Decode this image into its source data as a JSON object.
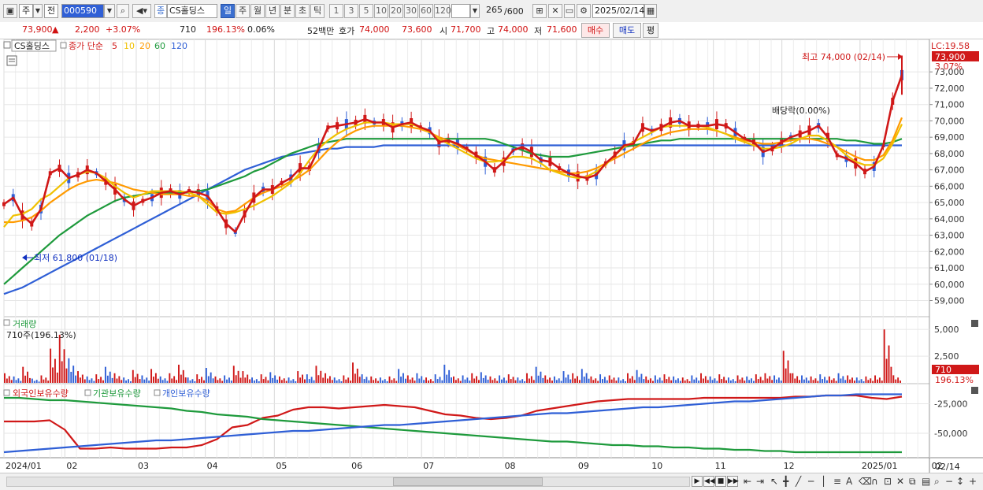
{
  "toolbar": {
    "period_type": "주",
    "prev_label": "전",
    "stock_code": "000590",
    "stock_badge": "종",
    "stock_name": "CS홀딩스",
    "period_tabs": [
      "일",
      "주",
      "월",
      "년",
      "분",
      "초",
      "틱"
    ],
    "interval_buttons": [
      "1",
      "3",
      "5",
      "10",
      "20",
      "30",
      "60",
      "120"
    ],
    "count_value": "265",
    "count_total": "/600",
    "date_value": "2025/02/14"
  },
  "info": {
    "price": "73,900",
    "change_arrow": "▲",
    "change": "2,200",
    "change_pct": "+3.07%",
    "volume": "710",
    "volume_ratio": "196.13%",
    "turnover": "0.06%",
    "week52_label": "52백만",
    "ask_label": "호가",
    "ask": "74,000",
    "bid": "73,600",
    "open_label": "시",
    "open": "71,700",
    "high_label": "고",
    "high": "74,000",
    "low_label": "저",
    "low": "71,600",
    "buy_button": "매수",
    "sell_button": "매도",
    "eval_button": "평"
  },
  "chart_data": [
    {
      "type": "candlestick",
      "legend": {
        "stock": "CS홀딩스",
        "ma_label": "종가 단순",
        "periods": [
          "5",
          "10",
          "20",
          "60",
          "120"
        ],
        "colors": [
          "#d01818",
          "#f0c000",
          "#ff9a00",
          "#1e9a3c",
          "#2f5fd6"
        ]
      },
      "y_ticks": [
        59000,
        60000,
        61000,
        62000,
        63000,
        64000,
        65000,
        66000,
        67000,
        68000,
        69000,
        70000,
        71000,
        72000,
        73000
      ],
      "y_tick_labels": [
        "59,000",
        "60,000",
        "61,000",
        "62,000",
        "63,000",
        "64,000",
        "65,000",
        "66,000",
        "67,000",
        "68,000",
        "69,000",
        "70,000",
        "71,000",
        "72,000",
        "73,000"
      ],
      "ylim": [
        58300,
        74700
      ],
      "lc_label": "LC:19.58",
      "last_price_label": "73,900",
      "last_pct_label": "3.07%",
      "last_price": 73900,
      "high_annotation": "최고 74,000 (02/14)",
      "high_value": 74000,
      "low_annotation": "최저 61,800 (01/18)",
      "low_value": 61800,
      "dividend_annotation": "배당락(0.00%)",
      "series": [
        {
          "name": "5",
          "color": "#d01818",
          "values": [
            64900,
            65300,
            64200,
            63700,
            64600,
            66800,
            67100,
            66500,
            66700,
            67000,
            66800,
            66300,
            65800,
            65200,
            64800,
            65100,
            65300,
            65600,
            65700,
            65500,
            65700,
            65600,
            65400,
            64600,
            63700,
            63200,
            64300,
            65300,
            65800,
            65800,
            66200,
            66500,
            67100,
            67100,
            68300,
            69600,
            69700,
            69800,
            69900,
            70100,
            69900,
            69900,
            69600,
            69800,
            69900,
            69600,
            69400,
            68700,
            68800,
            68600,
            68300,
            67900,
            67500,
            67000,
            67500,
            68200,
            68400,
            68100,
            67600,
            67500,
            67100,
            66800,
            66600,
            66500,
            66700,
            67400,
            67900,
            68500,
            68600,
            69600,
            69400,
            69600,
            69900,
            70000,
            69700,
            69700,
            69700,
            69800,
            69700,
            69300,
            68900,
            68700,
            68100,
            68300,
            68700,
            69000,
            69200,
            69400,
            69700,
            69000,
            67900,
            67700,
            67400,
            66900,
            67200,
            68500,
            71200,
            72800
          ]
        },
        {
          "name": "10",
          "color": "#f0c000",
          "values": [
            63500,
            64200,
            64300,
            64600,
            65200,
            65500,
            66000,
            66500,
            66700,
            66900,
            66800,
            66500,
            66000,
            65600,
            65300,
            65500,
            65700,
            65700,
            65700,
            65700,
            65600,
            65400,
            64900,
            64400,
            64300,
            64400,
            64600,
            64800,
            65100,
            65400,
            65800,
            66200,
            66800,
            67600,
            68300,
            68800,
            69200,
            69500,
            69700,
            69900,
            69900,
            69900,
            69800,
            69800,
            69800,
            69600,
            69300,
            68900,
            68600,
            68300,
            68000,
            67700,
            67500,
            67500,
            67600,
            67800,
            67800,
            67700,
            67400,
            67000,
            66800,
            66600,
            66500,
            66600,
            66900,
            67300,
            67900,
            68400,
            68700,
            69000,
            69300,
            69600,
            69700,
            69700,
            69700,
            69700,
            69600,
            69400,
            69200,
            68900,
            68700,
            68500,
            68300,
            68300,
            68400,
            68600,
            68900,
            69100,
            69100,
            68800,
            68400,
            67900,
            67500,
            67300,
            67300,
            67700,
            68600,
            69800
          ]
        },
        {
          "name": "20",
          "color": "#ff9a00",
          "values": [
            63800,
            63800,
            63900,
            64100,
            64500,
            65000,
            65400,
            65800,
            66100,
            66300,
            66400,
            66300,
            66200,
            66000,
            65800,
            65700,
            65600,
            65500,
            65500,
            65500,
            65400,
            65400,
            65100,
            64600,
            64400,
            64500,
            64900,
            65300,
            65600,
            65800,
            66000,
            66300,
            66600,
            67000,
            67600,
            68200,
            68700,
            69100,
            69400,
            69600,
            69700,
            69700,
            69700,
            69700,
            69600,
            69500,
            69300,
            69000,
            68800,
            68500,
            68200,
            67900,
            67700,
            67600,
            67500,
            67400,
            67300,
            67200,
            67100,
            67000,
            66900,
            66800,
            66800,
            66900,
            67100,
            67400,
            67700,
            68000,
            68300,
            68600,
            68900,
            69100,
            69300,
            69400,
            69500,
            69500,
            69500,
            69400,
            69200,
            69000,
            68800,
            68700,
            68600,
            68600,
            68700,
            68800,
            68900,
            68900,
            68800,
            68600,
            68400,
            68100,
            67800,
            67600,
            67600,
            67900,
            68800,
            70200
          ]
        },
        {
          "name": "60",
          "color": "#1e9a3c",
          "values": [
            60000,
            60500,
            61000,
            61500,
            62000,
            62500,
            63000,
            63400,
            63800,
            64200,
            64500,
            64800,
            65100,
            65300,
            65400,
            65500,
            65600,
            65600,
            65600,
            65600,
            65600,
            65700,
            65800,
            66000,
            66200,
            66400,
            66600,
            66900,
            67100,
            67400,
            67700,
            68000,
            68200,
            68400,
            68600,
            68700,
            68800,
            68900,
            68900,
            68900,
            68900,
            68900,
            68900,
            68900,
            68900,
            68900,
            68900,
            68900,
            68900,
            68900,
            68900,
            68900,
            68900,
            68800,
            68600,
            68400,
            68200,
            68000,
            67900,
            67800,
            67800,
            67800,
            67900,
            68000,
            68100,
            68200,
            68300,
            68400,
            68500,
            68600,
            68700,
            68800,
            68800,
            68900,
            68900,
            68900,
            68900,
            68900,
            68900,
            68900,
            68900,
            68900,
            68900,
            68900,
            68900,
            68900,
            68900,
            68900,
            68900,
            68900,
            68900,
            68800,
            68800,
            68700,
            68600,
            68600,
            68700,
            68900
          ]
        },
        {
          "name": "120",
          "color": "#2f5fd6",
          "values": [
            59400,
            59600,
            59800,
            60100,
            60400,
            60700,
            61000,
            61300,
            61600,
            61900,
            62200,
            62500,
            62800,
            63100,
            63400,
            63700,
            64000,
            64300,
            64600,
            64900,
            65200,
            65500,
            65800,
            66100,
            66400,
            66700,
            67000,
            67200,
            67400,
            67600,
            67800,
            67900,
            68000,
            68100,
            68200,
            68300,
            68300,
            68400,
            68400,
            68400,
            68400,
            68500,
            68500,
            68500,
            68500,
            68500,
            68500,
            68500,
            68500,
            68500,
            68500,
            68500,
            68500,
            68500,
            68500,
            68500,
            68500,
            68500,
            68500,
            68500,
            68500,
            68500,
            68500,
            68500,
            68500,
            68500,
            68500,
            68500,
            68500,
            68500,
            68500,
            68500,
            68500,
            68500,
            68500,
            68500,
            68500,
            68500,
            68500,
            68500,
            68500,
            68500,
            68500,
            68500,
            68500,
            68500,
            68500,
            68500,
            68500,
            68500,
            68500,
            68500,
            68500,
            68500,
            68500,
            68500,
            68500,
            68500
          ]
        }
      ]
    },
    {
      "type": "bar",
      "title": "거래량",
      "subtitle": "710주(196.13%)",
      "y_ticks": [
        2500,
        5000
      ],
      "y_tick_labels": [
        "2,500",
        "5,000"
      ],
      "ylim": [
        0,
        5600
      ],
      "last_volume_label": "710",
      "last_pct_label": "196.13%",
      "values": [
        900,
        600,
        1500,
        400,
        700,
        3200,
        4500,
        2300,
        1100,
        600,
        800,
        1500,
        900,
        500,
        1200,
        700,
        1300,
        600,
        900,
        1700,
        500,
        800,
        1400,
        600,
        700,
        1600,
        1100,
        500,
        800,
        1000,
        600,
        500,
        1100,
        800,
        1600,
        900,
        500,
        700,
        1900,
        800,
        600,
        500,
        600,
        1300,
        700,
        900,
        500,
        800,
        1700,
        600,
        700,
        900,
        1000,
        600,
        700,
        800,
        500,
        900,
        1500,
        700,
        600,
        1100,
        900,
        1300,
        600,
        800,
        700,
        500,
        900,
        1200,
        600,
        700,
        800,
        600,
        500,
        700,
        900,
        600,
        800,
        500,
        700,
        600,
        800,
        900,
        700,
        3000,
        900,
        700,
        600,
        800,
        600,
        900,
        700,
        500,
        600,
        700,
        5000,
        710
      ],
      "colors": [
        "r",
        "b",
        "r",
        "b",
        "r",
        "r",
        "r",
        "b",
        "r",
        "b",
        "r",
        "b",
        "r",
        "b",
        "r",
        "b",
        "r",
        "b",
        "r",
        "r",
        "b",
        "r",
        "b",
        "r",
        "b",
        "r",
        "r",
        "b",
        "r",
        "b",
        "r",
        "b",
        "r",
        "b",
        "r",
        "r",
        "b",
        "r",
        "r",
        "b",
        "r",
        "b",
        "r",
        "b",
        "r",
        "b",
        "r",
        "b",
        "b",
        "r",
        "b",
        "r",
        "b",
        "r",
        "b",
        "r",
        "b",
        "r",
        "b",
        "r",
        "b",
        "b",
        "r",
        "b",
        "r",
        "b",
        "r",
        "b",
        "r",
        "b",
        "r",
        "b",
        "r",
        "b",
        "r",
        "b",
        "r",
        "b",
        "r",
        "b",
        "r",
        "b",
        "r",
        "r",
        "b",
        "r",
        "r",
        "b",
        "r",
        "b",
        "r",
        "b",
        "r",
        "b",
        "r",
        "r",
        "r",
        "r"
      ]
    },
    {
      "type": "line",
      "legend": [
        "외국인보유수량",
        "기관보유수량",
        "개인보유수량"
      ],
      "y_ticks": [
        -25000,
        -50000
      ],
      "y_tick_labels": [
        "-25,000",
        "-50,000"
      ],
      "ylim": [
        -68000,
        -12000
      ],
      "series": [
        {
          "name": "외국인보유수량",
          "color": "#d01818",
          "values": [
            -40000,
            -40000,
            -40000,
            -39000,
            -47000,
            -63000,
            -63000,
            -62000,
            -63000,
            -63000,
            -63000,
            -62000,
            -62000,
            -60000,
            -55000,
            -45000,
            -43000,
            -37000,
            -35000,
            -30000,
            -28000,
            -28000,
            -29000,
            -28000,
            -27000,
            -26000,
            -27000,
            -28000,
            -31000,
            -34000,
            -35000,
            -37000,
            -38000,
            -37000,
            -35000,
            -31000,
            -29000,
            -27000,
            -25000,
            -23000,
            -22000,
            -21000,
            -21000,
            -21000,
            -21000,
            -21000,
            -20000,
            -20000,
            -20000,
            -20000,
            -20000,
            -20000,
            -19000,
            -19000,
            -18000,
            -18000,
            -18000,
            -20000,
            -21000,
            -19000
          ]
        },
        {
          "name": "기관보유수량",
          "color": "#1e9a3c",
          "values": [
            -20000,
            -20000,
            -21000,
            -22000,
            -22000,
            -23000,
            -24000,
            -25000,
            -26000,
            -27000,
            -28000,
            -29000,
            -31000,
            -32000,
            -34000,
            -35000,
            -36000,
            -38000,
            -39000,
            -40000,
            -41000,
            -42000,
            -43000,
            -44000,
            -45000,
            -46000,
            -47000,
            -48000,
            -49000,
            -50000,
            -51000,
            -52000,
            -53000,
            -54000,
            -55000,
            -56000,
            -57000,
            -57000,
            -58000,
            -59000,
            -60000,
            -60000,
            -61000,
            -61000,
            -62000,
            -62000,
            -63000,
            -63000,
            -64000,
            -64000,
            -65000,
            -65000,
            -66000,
            -66000,
            -66000,
            -66000,
            -66000,
            -66000,
            -66000,
            -66000
          ]
        },
        {
          "name": "개인보유수량",
          "color": "#2f5fd6",
          "values": [
            -66000,
            -65000,
            -64000,
            -63000,
            -62000,
            -61000,
            -60000,
            -59000,
            -58000,
            -57000,
            -56000,
            -56000,
            -55000,
            -54000,
            -53000,
            -52000,
            -51000,
            -50000,
            -49000,
            -48000,
            -48000,
            -47000,
            -46000,
            -45000,
            -44000,
            -43000,
            -43000,
            -42000,
            -41000,
            -40000,
            -39000,
            -38000,
            -37000,
            -36000,
            -35000,
            -34000,
            -33000,
            -33000,
            -32000,
            -31000,
            -30000,
            -29000,
            -28000,
            -28000,
            -27000,
            -26000,
            -25000,
            -24000,
            -23000,
            -23000,
            -22000,
            -21000,
            -20000,
            -19000,
            -18000,
            -18000,
            -17000,
            -17000,
            -17000,
            -17000
          ]
        }
      ]
    }
  ],
  "x_axis": {
    "labels": [
      "2024/01",
      "02",
      "03",
      "04",
      "05",
      "06",
      "07",
      "08",
      "09",
      "10",
      "11",
      "12",
      "2025/01",
      "02"
    ],
    "label_positions": [
      0,
      0.0708,
      0.1537,
      0.2339,
      0.3142,
      0.4019,
      0.4852,
      0.5798,
      0.6652,
      0.7506,
      0.8242,
      0.9038,
      0.9946,
      1.0758
    ],
    "right_label": "02/14"
  }
}
